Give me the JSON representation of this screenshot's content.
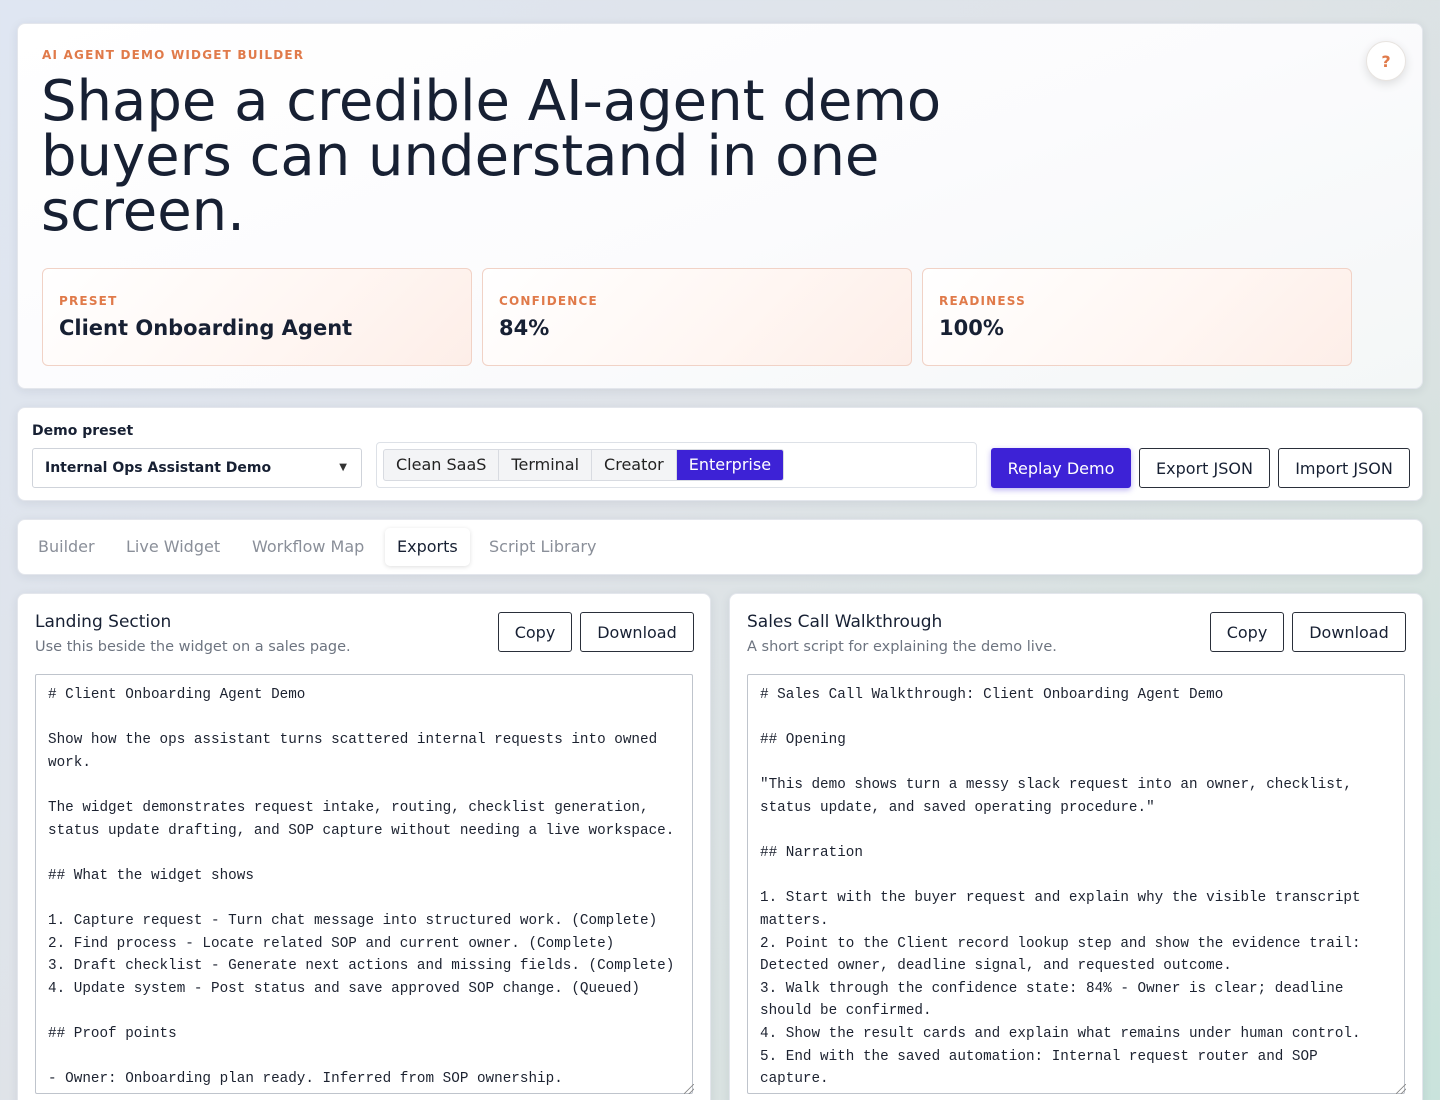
{
  "hero": {
    "eyebrow": "AI AGENT DEMO WIDGET BUILDER",
    "title": "Shape a credible AI-agent demo buyers can understand in one screen.",
    "help_label": "?",
    "stats": [
      {
        "label": "PRESET",
        "value": "Client Onboarding Agent"
      },
      {
        "label": "CONFIDENCE",
        "value": "84%"
      },
      {
        "label": "READINESS",
        "value": "100%"
      }
    ]
  },
  "controls": {
    "preset_label": "Demo preset",
    "preset_value": "Internal Ops Assistant Demo",
    "themes": [
      "Clean SaaS",
      "Terminal",
      "Creator",
      "Enterprise"
    ],
    "active_theme": "Enterprise",
    "replay_label": "Replay Demo",
    "export_label": "Export JSON",
    "import_label": "Import JSON"
  },
  "tabs": [
    {
      "label": "Builder",
      "active": false
    },
    {
      "label": "Live Widget",
      "active": false
    },
    {
      "label": "Workflow Map",
      "active": false
    },
    {
      "label": "Exports",
      "active": true
    },
    {
      "label": "Script Library",
      "active": false
    }
  ],
  "exports": {
    "left": {
      "title": "Landing Section",
      "subtitle": "Use this beside the widget on a sales page.",
      "copy_label": "Copy",
      "download_label": "Download",
      "content": "# Client Onboarding Agent Demo\n\nShow how the ops assistant turns scattered internal requests into owned work.\n\nThe widget demonstrates request intake, routing, checklist generation, status update drafting, and SOP capture without needing a live workspace.\n\n## What the widget shows\n\n1. Capture request - Turn chat message into structured work. (Complete)\n2. Find process - Locate related SOP and current owner. (Complete)\n3. Draft checklist - Generate next actions and missing fields. (Complete)\n4. Update system - Post status and save approved SOP change. (Queued)\n\n## Proof points\n\n- Owner: Onboarding plan ready. Inferred from SOP ownership."
    },
    "right": {
      "title": "Sales Call Walkthrough",
      "subtitle": "A short script for explaining the demo live.",
      "copy_label": "Copy",
      "download_label": "Download",
      "content": "# Sales Call Walkthrough: Client Onboarding Agent Demo\n\n## Opening\n\n\"This demo shows turn a messy slack request into an owner, checklist, status update, and saved operating procedure.\"\n\n## Narration\n\n1. Start with the buyer request and explain why the visible transcript matters.\n2. Point to the Client record lookup step and show the evidence trail: Detected owner, deadline signal, and requested outcome.\n3. Walk through the confidence state: 84% - Owner is clear; deadline should be confirmed.\n4. Show the result cards and explain what remains under human control.\n5. End with the saved automation: Internal request router and SOP capture."
    }
  },
  "colors": {
    "accent": "#3d22d6",
    "eyebrow": "#e07a4a",
    "text": "#172033"
  }
}
